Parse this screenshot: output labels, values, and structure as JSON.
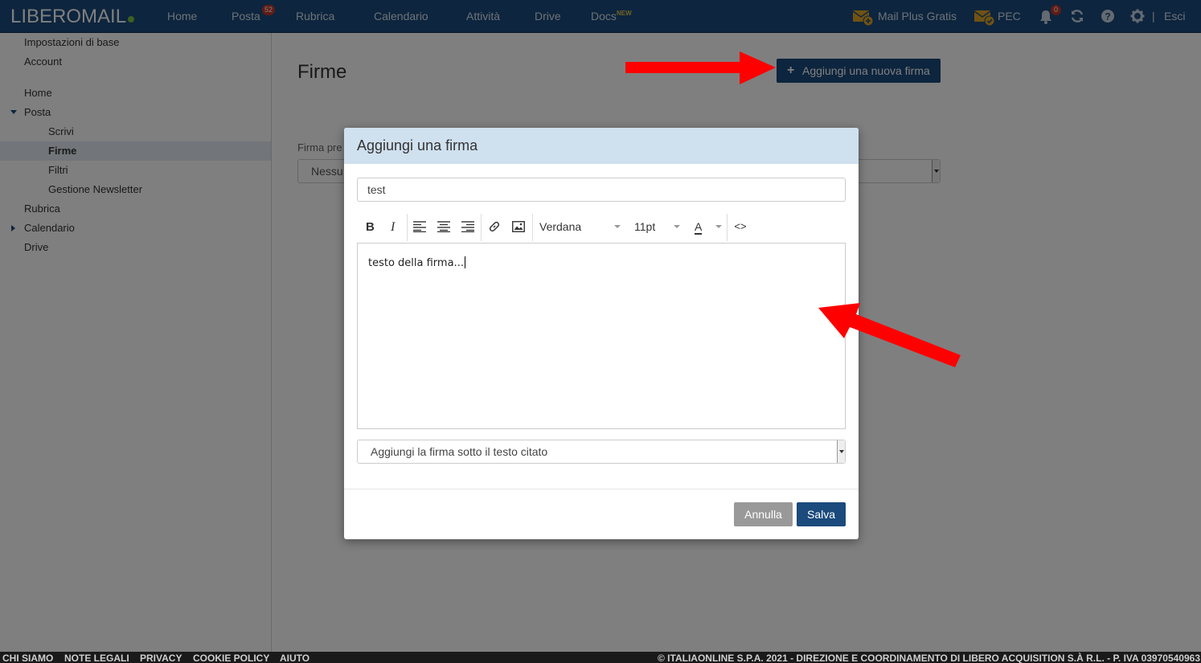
{
  "brand": {
    "part1": "LIBERO",
    "part2": "MAIL"
  },
  "nav": [
    {
      "label": "Home"
    },
    {
      "label": "Posta",
      "badge": "52"
    },
    {
      "label": "Rubrica"
    },
    {
      "label": "Calendario"
    },
    {
      "label": "Attività"
    },
    {
      "label": "Drive"
    },
    {
      "label": "Docs",
      "tag": "NEW"
    }
  ],
  "top_right": {
    "mail_plus": "Mail Plus Gratis",
    "pec": "PEC",
    "notifications_count": "0",
    "separator": "|",
    "logout": "Esci"
  },
  "sidebar": {
    "items": [
      {
        "label": "Impostazioni di base"
      },
      {
        "label": "Account"
      },
      {
        "label": "Home"
      },
      {
        "label": "Posta"
      },
      {
        "label": "Scrivi"
      },
      {
        "label": "Firme"
      },
      {
        "label": "Filtri"
      },
      {
        "label": "Gestione Newsletter"
      },
      {
        "label": "Rubrica"
      },
      {
        "label": "Calendario"
      },
      {
        "label": "Drive"
      }
    ]
  },
  "main": {
    "title": "Firme",
    "add_button": "Aggiungi una nuova firma",
    "default_label": "Firma pre",
    "default_value": "Nessu"
  },
  "modal": {
    "title": "Aggiungi una firma",
    "name_value": "test",
    "font": "Verdana",
    "font_size": "11pt",
    "text_color_glyph": "A",
    "code_glyph": "<>",
    "editor_text": "testo della firma...",
    "position_option": "Aggiungi la firma sotto il testo citato",
    "cancel": "Annulla",
    "save": "Salva"
  },
  "footer": {
    "links": [
      "CHI SIAMO",
      "NOTE LEGALI",
      "PRIVACY",
      "COOKIE POLICY",
      "AIUTO"
    ],
    "copyright": "© ITALIAONLINE S.P.A. 2021 - DIREZIONE E COORDINAMENTO DI LIBERO ACQUISITION S.À R.L. - P. IVA 03970540963"
  },
  "colors": {
    "brand_blue": "#1b4a7c",
    "logo_green": "#7cc142",
    "badge_red": "#c0392b",
    "annotation_red": "#ff0000"
  }
}
